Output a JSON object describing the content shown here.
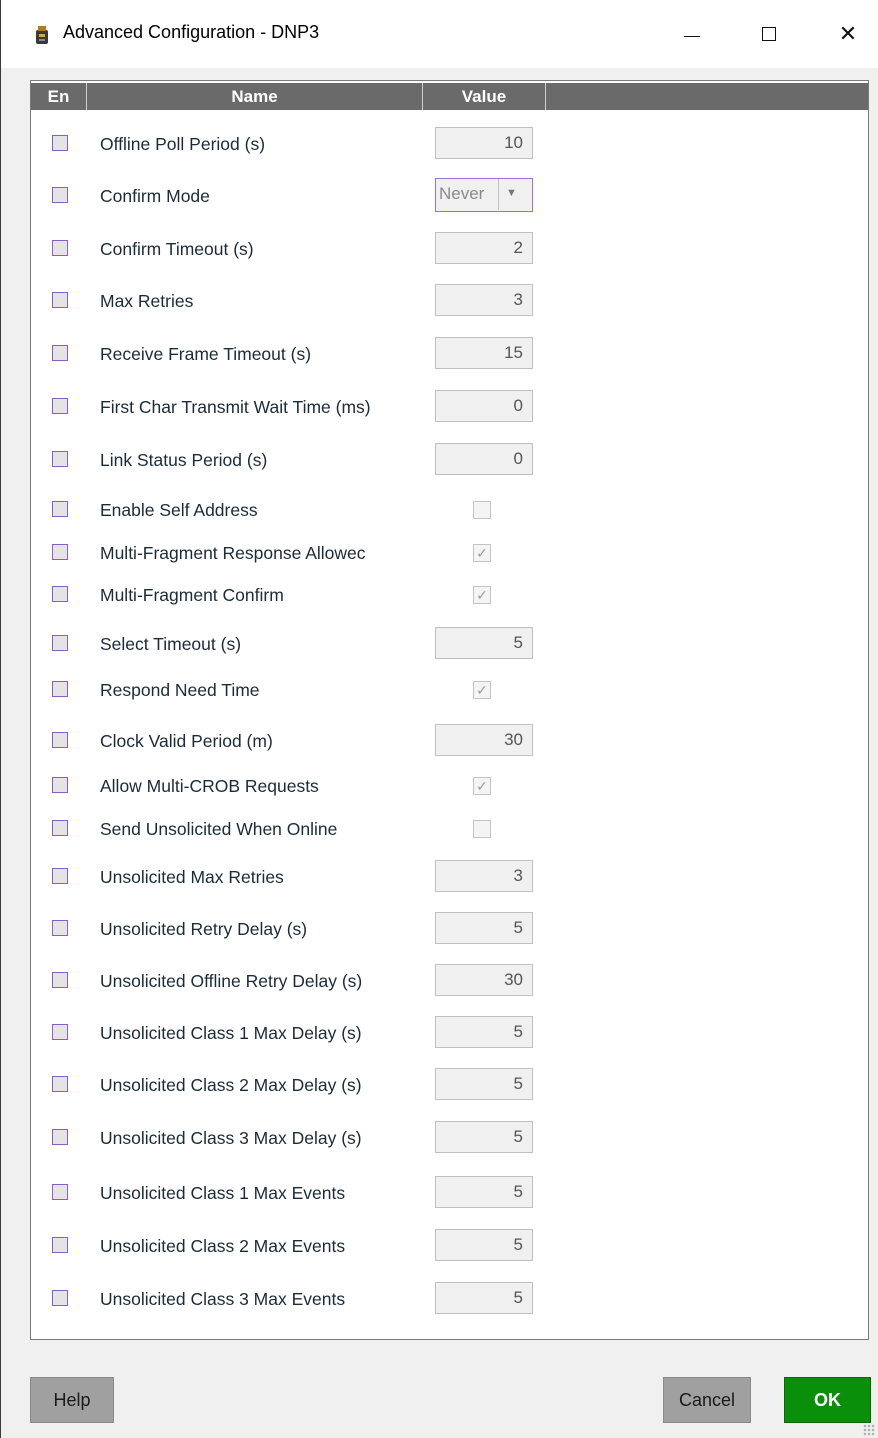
{
  "window": {
    "title": "Advanced Configuration - DNP3",
    "app_icon": "app-icon",
    "controls": {
      "minimize": "minimize-icon",
      "maximize": "maximize-icon",
      "close": "close-icon",
      "close_glyph": "✕"
    }
  },
  "grid": {
    "headers": {
      "en": "En",
      "name": "Name",
      "value": "Value"
    },
    "rows": [
      {
        "name": "Offline Poll Period (s)",
        "type": "number",
        "value": "10",
        "enabled": false
      },
      {
        "name": "Confirm Mode",
        "type": "select",
        "value": "Never",
        "enabled": false
      },
      {
        "name": "Confirm Timeout (s)",
        "type": "number",
        "value": "2",
        "enabled": false
      },
      {
        "name": "Max Retries",
        "type": "number",
        "value": "3",
        "enabled": false
      },
      {
        "name": "Receive Frame Timeout (s)",
        "type": "number",
        "value": "15",
        "enabled": false
      },
      {
        "name": "First Char Transmit Wait Time (ms)",
        "type": "number",
        "value": "0",
        "enabled": false
      },
      {
        "name": "Link Status Period (s)",
        "type": "number",
        "value": "0",
        "enabled": false
      },
      {
        "name": "Enable Self Address",
        "type": "checkbox",
        "checked": false,
        "enabled": false
      },
      {
        "name": "Multi-Fragment Response Allowec",
        "type": "checkbox",
        "checked": true,
        "enabled": false
      },
      {
        "name": "Multi-Fragment Confirm",
        "type": "checkbox",
        "checked": true,
        "enabled": false
      },
      {
        "name": "Select Timeout (s)",
        "type": "number",
        "value": "5",
        "enabled": false
      },
      {
        "name": "Respond Need Time",
        "type": "checkbox",
        "checked": true,
        "enabled": false
      },
      {
        "name": "Clock Valid Period (m)",
        "type": "number",
        "value": "30",
        "enabled": false
      },
      {
        "name": "Allow Multi-CROB Requests",
        "type": "checkbox",
        "checked": true,
        "enabled": false
      },
      {
        "name": "Send Unsolicited When Online",
        "type": "checkbox",
        "checked": false,
        "enabled": false
      },
      {
        "name": "Unsolicited Max Retries",
        "type": "number",
        "value": "3",
        "enabled": false
      },
      {
        "name": "Unsolicited Retry Delay (s)",
        "type": "number",
        "value": "5",
        "enabled": false
      },
      {
        "name": "Unsolicited Offline Retry Delay (s)",
        "type": "number",
        "value": "30",
        "enabled": false
      },
      {
        "name": "Unsolicited Class 1 Max Delay (s)",
        "type": "number",
        "value": "5",
        "enabled": false
      },
      {
        "name": "Unsolicited Class 2 Max Delay (s)",
        "type": "number",
        "value": "5",
        "enabled": false
      },
      {
        "name": "Unsolicited Class 3 Max Delay (s)",
        "type": "number",
        "value": "5",
        "enabled": false
      },
      {
        "name": "Unsolicited Class 1 Max Events",
        "type": "number",
        "value": "5",
        "enabled": false
      },
      {
        "name": "Unsolicited Class 2 Max Events",
        "type": "number",
        "value": "5",
        "enabled": false
      },
      {
        "name": "Unsolicited Class 3 Max Events",
        "type": "number",
        "value": "5",
        "enabled": false
      }
    ]
  },
  "buttons": {
    "help": "Help",
    "cancel": "Cancel",
    "ok": "OK"
  },
  "colors": {
    "ok_button": "#0a8f0a",
    "header_bg": "#6a6a6a",
    "checkbox_border": "#8a5ec8"
  }
}
